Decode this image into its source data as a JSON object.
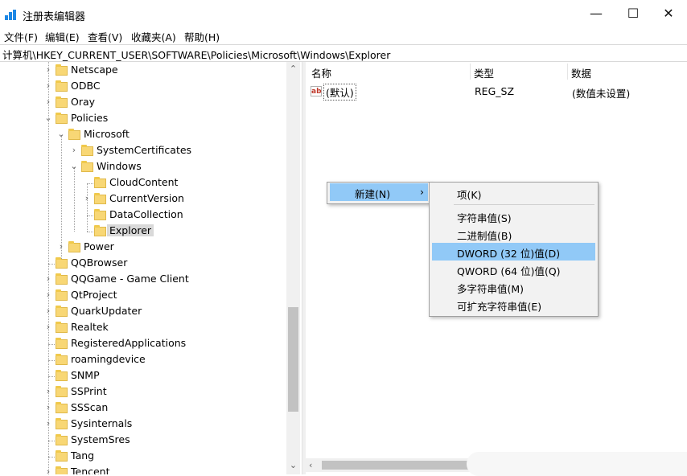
{
  "window": {
    "title": "注册表编辑器",
    "minimize_glyph": "—",
    "maximize_glyph": "☐",
    "close_glyph": "✕"
  },
  "menubar": [
    "文件(F)",
    "编辑(E)",
    "查看(V)",
    "收藏夹(A)",
    "帮助(H)"
  ],
  "address": "计算机\\HKEY_CURRENT_USER\\SOFTWARE\\Policies\\Microsoft\\Windows\\Explorer",
  "tree": {
    "items": [
      {
        "label": "Netscape",
        "level": 0,
        "expander": "collapsed"
      },
      {
        "label": "ODBC",
        "level": 0,
        "expander": "collapsed"
      },
      {
        "label": "Oray",
        "level": 0,
        "expander": "collapsed"
      },
      {
        "label": "Policies",
        "level": 0,
        "expander": "expanded"
      },
      {
        "label": "Microsoft",
        "level": 1,
        "expander": "expanded"
      },
      {
        "label": "SystemCertificates",
        "level": 2,
        "expander": "collapsed"
      },
      {
        "label": "Windows",
        "level": 2,
        "expander": "expanded"
      },
      {
        "label": "CloudContent",
        "level": 3,
        "expander": "none"
      },
      {
        "label": "CurrentVersion",
        "level": 3,
        "expander": "collapsed"
      },
      {
        "label": "DataCollection",
        "level": 3,
        "expander": "none"
      },
      {
        "label": "Explorer",
        "level": 3,
        "expander": "none",
        "selected": true
      },
      {
        "label": "Power",
        "level": 1,
        "expander": "collapsed"
      },
      {
        "label": "QQBrowser",
        "level": 0,
        "expander": "none"
      },
      {
        "label": "QQGame - Game Client",
        "level": 0,
        "expander": "collapsed"
      },
      {
        "label": "QtProject",
        "level": 0,
        "expander": "collapsed"
      },
      {
        "label": "QuarkUpdater",
        "level": 0,
        "expander": "collapsed"
      },
      {
        "label": "Realtek",
        "level": 0,
        "expander": "collapsed"
      },
      {
        "label": "RegisteredApplications",
        "level": 0,
        "expander": "none"
      },
      {
        "label": "roamingdevice",
        "level": 0,
        "expander": "none"
      },
      {
        "label": "SNMP",
        "level": 0,
        "expander": "none"
      },
      {
        "label": "SSPrint",
        "level": 0,
        "expander": "collapsed"
      },
      {
        "label": "SSScan",
        "level": 0,
        "expander": "collapsed"
      },
      {
        "label": "Sysinternals",
        "level": 0,
        "expander": "collapsed"
      },
      {
        "label": "SystemSres",
        "level": 0,
        "expander": "none"
      },
      {
        "label": "Tang",
        "level": 0,
        "expander": "none"
      },
      {
        "label": "Tencent",
        "level": 0,
        "expander": "collapsed"
      }
    ]
  },
  "list": {
    "headers": {
      "name": "名称",
      "type": "类型",
      "data": "数据"
    },
    "rows": [
      {
        "icon": "ab",
        "name": "(默认)",
        "type": "REG_SZ",
        "data": "(数值未设置)"
      }
    ]
  },
  "context_menu": {
    "new_label": "新建(N)",
    "arrow": "›",
    "submenu": {
      "key_item": "项(K)",
      "items": [
        "字符串值(S)",
        "二进制值(B)",
        "DWORD (32 位)值(D)",
        "QWORD (64 位)值(Q)",
        "多字符串值(M)",
        "可扩充字符串值(E)"
      ],
      "highlighted": 2
    }
  },
  "colors": {
    "highlight": "#91c9f7",
    "folder": "#f8d775",
    "selection": "#d9d9d9"
  }
}
